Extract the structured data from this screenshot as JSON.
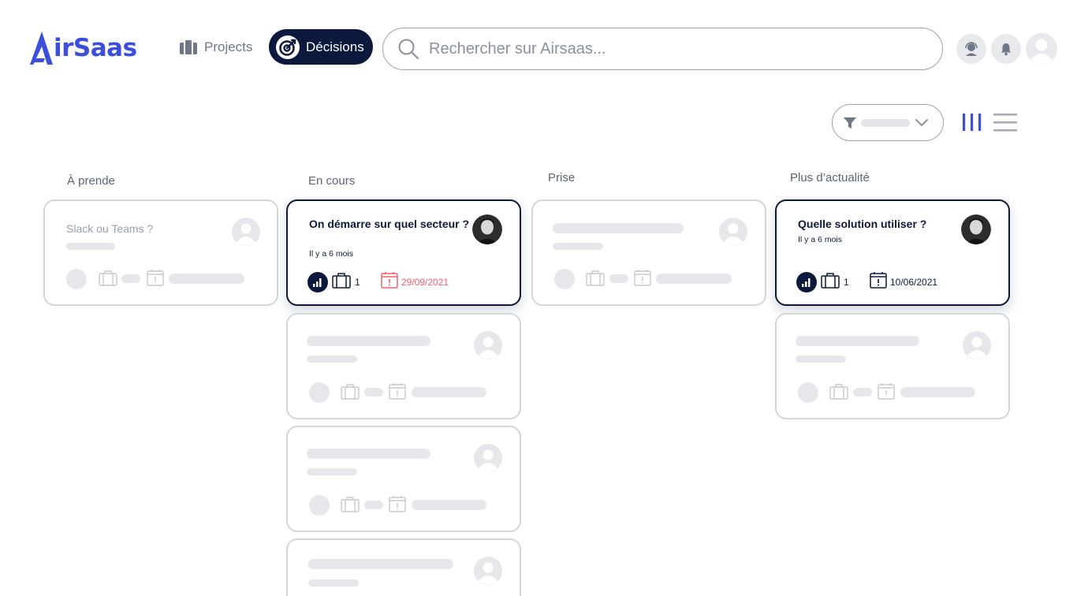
{
  "app": {
    "logo_text": "irSaas",
    "brand_color": "#3b4fd8",
    "navy": "#0b1a3c"
  },
  "nav": {
    "projects_label": "Projects",
    "decisions_label": "Décisions"
  },
  "search": {
    "placeholder": "Rechercher sur Airsaas..."
  },
  "columns": [
    {
      "title": "À prende"
    },
    {
      "title": "En cours"
    },
    {
      "title": "Prise"
    },
    {
      "title": "Plus d’actualité"
    }
  ],
  "cards": {
    "slack": {
      "title": "Slack ou Teams ?"
    },
    "secteur": {
      "title": "On démarre sur quel secteur ?",
      "subtitle": "Il y a 6 mois",
      "projects_count": "1",
      "due_date": "29/09/2021",
      "due_color": "#f0616b"
    },
    "solution": {
      "title": "Quelle solution utiliser ?",
      "subtitle": "Il y a 6 mois",
      "projects_count": "1",
      "due_date": "10/06/2021"
    }
  }
}
